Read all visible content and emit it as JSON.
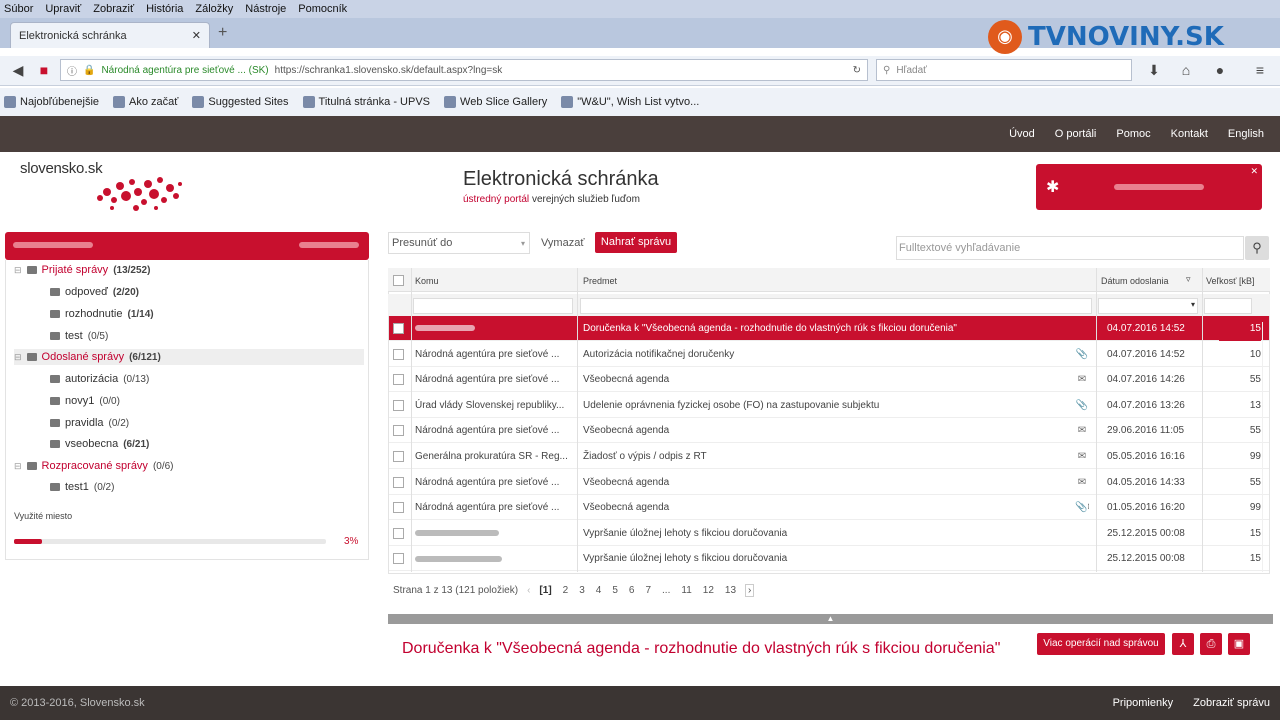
{
  "browser": {
    "menu": [
      "Súbor",
      "Upraviť",
      "Zobraziť",
      "História",
      "Záložky",
      "Nástroje",
      "Pomocník"
    ],
    "tab_title": "Elektronická schránka",
    "url_identity": "Národná agentúra pre sieťové ... (SK)",
    "url": "https://schranka1.slovensko.sk/default.aspx?lng=sk",
    "search_placeholder": "Hľadať",
    "bookmarks": [
      "Najobľúbenejšie",
      "Ako začať",
      "Suggested Sites",
      "Titulná stránka - UPVS",
      "Web Slice Gallery",
      "\"W&U\", Wish List vytvo..."
    ]
  },
  "watermark": {
    "text": "TVNOVINY.SK"
  },
  "site": {
    "topnav": [
      "Úvod",
      "O portáli",
      "Pomoc",
      "Kontakt",
      "English"
    ],
    "brand": "slovensko.sk",
    "title": "Elektronická schránka",
    "subtitle_red": "ústredný portál",
    "subtitle_rest": "verejných služieb ľuďom"
  },
  "sidebar": {
    "folders": [
      {
        "label": "Prijaté správy",
        "count": "(13/252)",
        "level": 0,
        "red": true,
        "bold": true
      },
      {
        "label": "odpoveď",
        "count": "(2/20)",
        "level": 1,
        "red": false,
        "bold": true
      },
      {
        "label": "rozhodnutie",
        "count": "(1/14)",
        "level": 1,
        "red": false,
        "bold": true
      },
      {
        "label": "test",
        "count": "(0/5)",
        "level": 1,
        "red": false,
        "bold": false
      },
      {
        "label": "Odoslané správy",
        "count": "(6/121)",
        "level": 0,
        "red": true,
        "bold": true
      },
      {
        "label": "autorizácia",
        "count": "(0/13)",
        "level": 1,
        "red": false,
        "bold": false
      },
      {
        "label": "novy1",
        "count": "(0/0)",
        "level": 1,
        "red": false,
        "bold": false
      },
      {
        "label": "pravidla",
        "count": "(0/2)",
        "level": 1,
        "red": false,
        "bold": false
      },
      {
        "label": "vseobecna",
        "count": "(6/21)",
        "level": 1,
        "red": false,
        "bold": true
      },
      {
        "label": "Rozpracované správy",
        "count": "(0/6)",
        "level": 0,
        "red": true,
        "bold": false
      },
      {
        "label": "test1",
        "count": "(0/2)",
        "level": 1,
        "red": false,
        "bold": false
      }
    ],
    "used_label": "Využité miesto",
    "used_percent_text": "3%",
    "used_fraction": 0.03
  },
  "toolbar": {
    "move_to": "Presunúť do",
    "clear": "Vymazať",
    "load": "Nahrať správu",
    "fulltext_placeholder": "Fulltextové vyhľadávanie"
  },
  "grid": {
    "columns": [
      "Komu",
      "Predmet",
      "Dátum odoslania",
      "Veľkosť [kB]"
    ],
    "rows": [
      {
        "to": "",
        "subject": "Doručenka k \"Všeobecná agenda - rozhodnutie do vlastných rúk s fikciou doručenia\"",
        "icon": "",
        "date": "04.07.2016 14:52",
        "size": "15",
        "selected": true
      },
      {
        "to": "Národná agentúra pre sieťové ...",
        "subject": "Autorizácia notifikačnej doručenky",
        "icon": "attachment-icon",
        "date": "04.07.2016 14:52",
        "size": "10",
        "selected": false
      },
      {
        "to": "Národná agentúra pre sieťové ...",
        "subject": "Všeobecná agenda",
        "icon": "envelope-icon",
        "date": "04.07.2016 14:26",
        "size": "55",
        "selected": false
      },
      {
        "to": "Úrad vlády Slovenskej republiky...",
        "subject": "Udelenie oprávnenia fyzickej osobe (FO) na zastupovanie subjektu",
        "icon": "attachment-icon",
        "date": "04.07.2016 13:26",
        "size": "13",
        "selected": false
      },
      {
        "to": "Národná agentúra pre sieťové ...",
        "subject": "Všeobecná agenda",
        "icon": "envelope-icon",
        "date": "29.06.2016 11:05",
        "size": "55",
        "selected": false
      },
      {
        "to": "Generálna prokuratúra SR - Reg...",
        "subject": "Žiadosť o výpis / odpis z RT",
        "icon": "envelope-icon",
        "date": "05.05.2016 16:16",
        "size": "99",
        "selected": false
      },
      {
        "to": "Národná agentúra pre sieťové ...",
        "subject": "Všeobecná agenda",
        "icon": "envelope-icon",
        "date": "04.05.2016 14:33",
        "size": "55",
        "selected": false
      },
      {
        "to": "Národná agentúra pre sieťové ...",
        "subject": "Všeobecná agenda",
        "icon": "attachment-envelope-icon",
        "date": "01.05.2016 16:20",
        "size": "99",
        "selected": false
      },
      {
        "to": "",
        "subject": "Vypršanie úložnej lehoty s fikciou doručovania",
        "icon": "",
        "date": "25.12.2015 00:08",
        "size": "15",
        "selected": false
      },
      {
        "to": "",
        "subject": "Vypršanie úložnej lehoty s fikciou doručovania",
        "icon": "",
        "date": "25.12.2015 00:08",
        "size": "15",
        "selected": false
      }
    ]
  },
  "pager": {
    "summary": "Strana 1 z 13 (121 položiek)",
    "pages": [
      "[1]",
      "2",
      "3",
      "4",
      "5",
      "6",
      "7",
      "...",
      "11",
      "12",
      "13"
    ]
  },
  "preview": {
    "title": "Doručenka k \"Všeobecná agenda - rozhodnutie do vlastných rúk s fikciou doručenia\"",
    "more_actions": "Viac operácií nad správou"
  },
  "footer": {
    "copyright": "© 2013-2016, Slovensko.sk",
    "links": [
      "Pripomienky",
      "Zobraziť správu"
    ]
  }
}
